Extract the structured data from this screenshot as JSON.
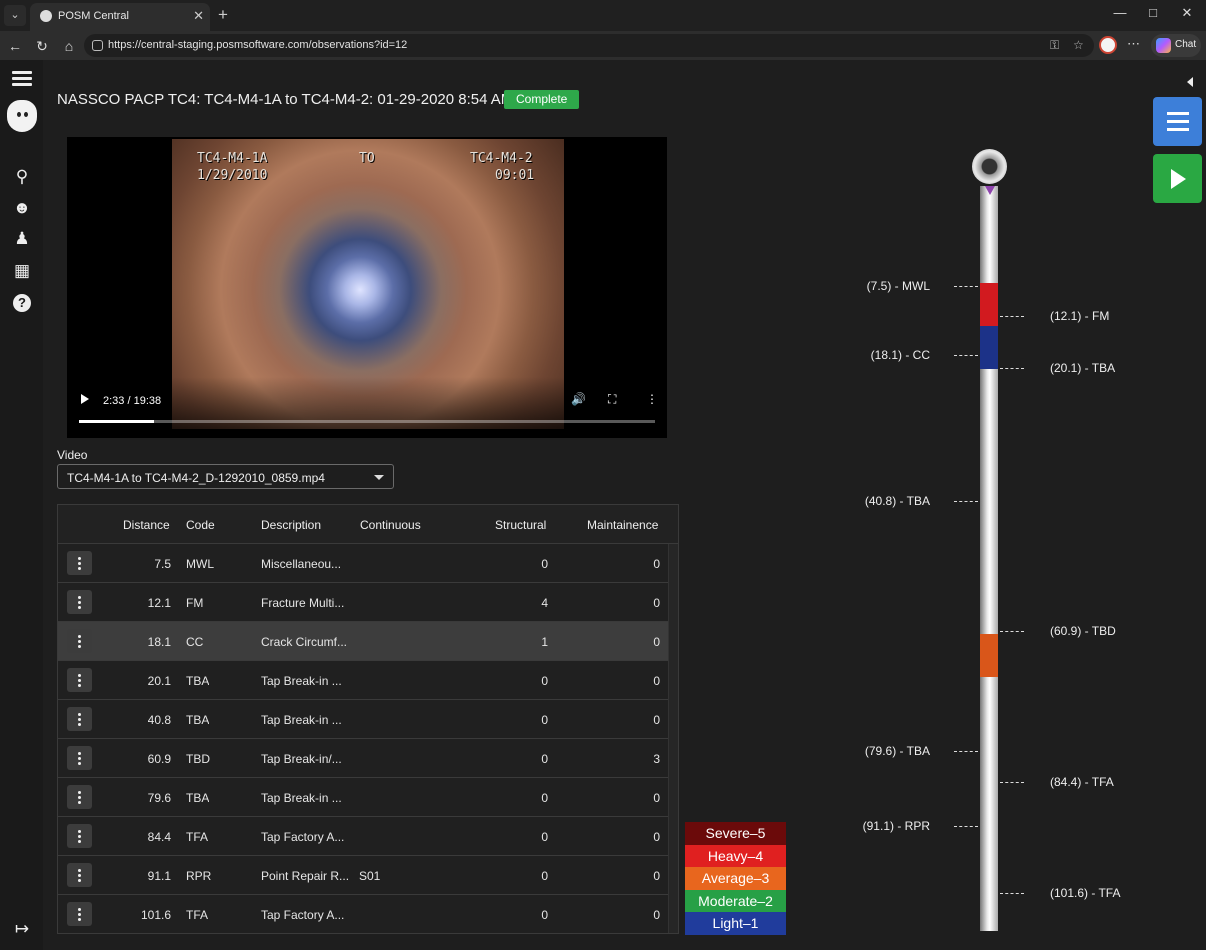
{
  "browser": {
    "tab_title": "POSM Central",
    "url": "https://central-staging.posmsoftware.com/observations?id=12",
    "chat_label": "Chat"
  },
  "page": {
    "title": "NASSCO PACP TC4: TC4-M4-1A to TC4-M4-2: 01-29-2020 8:54 AM",
    "status": "Complete"
  },
  "video": {
    "osd_start": "TC4-M4-1A",
    "osd_date": "1/29/2010",
    "osd_to": "TO",
    "osd_end": "TC4-M4-2",
    "osd_time": "09:01",
    "time_display": "2:33 / 19:38",
    "progress": 0.13,
    "label": "Video",
    "selected_file": "TC4-M4-1A to TC4-M4-2_D-1292010_0859.mp4"
  },
  "table": {
    "headers": {
      "distance": "Distance",
      "code": "Code",
      "description": "Description",
      "continuous": "Continuous",
      "structural": "Structural",
      "maintainence": "Maintainence"
    },
    "rows": [
      {
        "distance": "7.5",
        "code": "MWL",
        "description": "Miscellaneou...",
        "continuous": "",
        "structural": "0",
        "maintainence": "0"
      },
      {
        "distance": "12.1",
        "code": "FM",
        "description": "Fracture Multi...",
        "continuous": "",
        "structural": "4",
        "maintainence": "0"
      },
      {
        "distance": "18.1",
        "code": "CC",
        "description": "Crack Circumf...",
        "continuous": "",
        "structural": "1",
        "maintainence": "0"
      },
      {
        "distance": "20.1",
        "code": "TBA",
        "description": "Tap Break-in ...",
        "continuous": "",
        "structural": "0",
        "maintainence": "0"
      },
      {
        "distance": "40.8",
        "code": "TBA",
        "description": "Tap Break-in ...",
        "continuous": "",
        "structural": "0",
        "maintainence": "0"
      },
      {
        "distance": "60.9",
        "code": "TBD",
        "description": "Tap Break-in/...",
        "continuous": "",
        "structural": "0",
        "maintainence": "3"
      },
      {
        "distance": "79.6",
        "code": "TBA",
        "description": "Tap Break-in ...",
        "continuous": "",
        "structural": "0",
        "maintainence": "0"
      },
      {
        "distance": "84.4",
        "code": "TFA",
        "description": "Tap Factory A...",
        "continuous": "",
        "structural": "0",
        "maintainence": "0"
      },
      {
        "distance": "91.1",
        "code": "RPR",
        "description": "Point Repair R...",
        "continuous": "S01",
        "structural": "0",
        "maintainence": "0"
      },
      {
        "distance": "101.6",
        "code": "TFA",
        "description": "Tap Factory A...",
        "continuous": "",
        "structural": "0",
        "maintainence": "0"
      }
    ],
    "selected_row_index": 2
  },
  "legend": [
    {
      "label": "Severe–5",
      "color": "#6b0a0a"
    },
    {
      "label": "Heavy–4",
      "color": "#e02020"
    },
    {
      "label": "Average–3",
      "color": "#e8661e"
    },
    {
      "label": "Moderate–2",
      "color": "#27a046"
    },
    {
      "label": "Light–1",
      "color": "#203c9c"
    }
  ],
  "pipe": {
    "total_length": 103.6,
    "observations": [
      {
        "distance": 7.5,
        "label": "(7.5) - MWL"
      },
      {
        "distance": 12.1,
        "label": "(12.1) - FM"
      },
      {
        "distance": 18.1,
        "label": "(18.1) - CC"
      },
      {
        "distance": 20.1,
        "label": "(20.1) - TBA"
      },
      {
        "distance": 40.8,
        "label": "(40.8) - TBA"
      },
      {
        "distance": 60.9,
        "label": "(60.9) - TBD"
      },
      {
        "distance": 79.6,
        "label": "(79.6) - TBA"
      },
      {
        "distance": 84.4,
        "label": "(84.4) - TFA"
      },
      {
        "distance": 91.1,
        "label": "(91.1) - RPR"
      },
      {
        "distance": 101.6,
        "label": "(101.6) - TFA"
      }
    ],
    "defect_segments": [
      {
        "from": 12.1,
        "to": 18.1,
        "color": "#d21a1f"
      },
      {
        "from": 18.1,
        "to": 24.1,
        "color": "#1c3288"
      },
      {
        "from": 60.9,
        "to": 66.9,
        "color": "#d9561a"
      }
    ],
    "flow_arrow_color": "#8e44ad"
  },
  "sidebar_icons": [
    "menu-icon",
    "posm-logo",
    "search-icon",
    "users-icon",
    "user-icon",
    "map-icon",
    "help-icon",
    "logout-icon"
  ]
}
